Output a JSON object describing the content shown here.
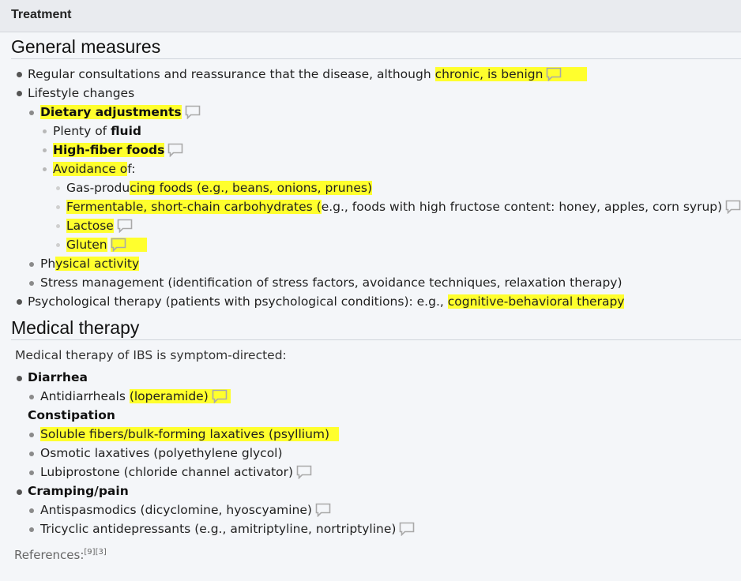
{
  "header": {
    "title": "Treatment"
  },
  "general": {
    "heading": "General measures",
    "reassurance": {
      "prefix": "Regular consultations and reassurance that the disease, although ",
      "highlight": "chronic, is benign"
    },
    "lifestyle": "Lifestyle changes",
    "dietary": "Dietary adjustments",
    "fluid": {
      "prefix": "Plenty of ",
      "bold": "fluid"
    },
    "fiber": "High-fiber foods",
    "avoidance": {
      "highlight": "Avoidance o",
      "rest": "f:"
    },
    "gas": {
      "prefix": "Gas-produ",
      "highlight": "cing foods (e.g., beans, onions, prunes)"
    },
    "fodmap": {
      "highlight": "Fermentable, short-chain carbohydrates (",
      "rest": "e.g., foods with high fructose content: honey, apples, corn syrup)"
    },
    "lactose": "Lactose",
    "gluten": "Gluten",
    "physical": {
      "prefix": "Ph",
      "highlight": "ysical activity"
    },
    "stress": "Stress management (identification of stress factors, avoidance techniques, relaxation therapy)",
    "psych": {
      "prefix": "Psychological therapy (patients with psychological conditions): e.g., ",
      "highlight": "cognitive-behavioral therapy"
    }
  },
  "medical": {
    "heading": "Medical therapy",
    "intro": "Medical therapy of IBS is symptom-directed:",
    "diarrhea": "Diarrhea",
    "antidiarrheals": {
      "prefix": "Antidiarrheals ",
      "highlight": "(loperamide)"
    },
    "constipation": "Constipation",
    "soluble": "Soluble fibers/bulk-forming laxatives (psyllium)",
    "osmotic": "Osmotic laxatives (polyethylene glycol)",
    "lubiprostone": "Lubiprostone (chloride channel activator)",
    "cramping": "Cramping/pain",
    "antispasmodics": "Antispasmodics (dicyclomine, hyoscyamine)",
    "tricyclic": "Tricyclic antidepressants (e.g., amitriptyline, nortriptyline)"
  },
  "references": {
    "label": "References:",
    "cites": "[9][3]"
  }
}
